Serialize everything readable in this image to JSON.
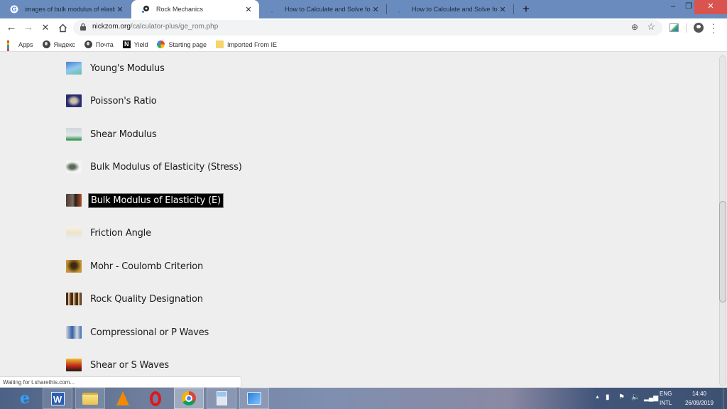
{
  "browser": {
    "tabs": [
      {
        "title": "images of bulk modulus of elastic",
        "favicon": "google-icon",
        "active": false
      },
      {
        "title": "Rock Mechanics",
        "favicon": "nickzom-icon",
        "active": true
      },
      {
        "title": "How to Calculate and Solve for S",
        "favicon": "loading-icon",
        "active": false
      },
      {
        "title": "How to Calculate and Solve for B",
        "favicon": "loading-icon",
        "active": false
      }
    ],
    "new_tab_label": "+",
    "window_controls": {
      "minimize": "–",
      "restore": "❐",
      "close": "✕"
    },
    "url": {
      "host": "nickzom.org",
      "path": "/calculator-plus/ge_rom.php"
    },
    "loading": true,
    "bookmarks": [
      {
        "label": "Apps",
        "icon": "apps-grid-icon"
      },
      {
        "label": "Яндекс",
        "icon": "globe-icon"
      },
      {
        "label": "Почта",
        "icon": "globe-icon"
      },
      {
        "label": "Yield",
        "icon": "yield-icon"
      },
      {
        "label": "Starting page",
        "icon": "starting-page-icon"
      },
      {
        "label": "Imported From IE",
        "icon": "folder-icon"
      }
    ],
    "status_text": "Waiting for t.sharethis.com...",
    "scroll_position_fraction": 0.44
  },
  "page": {
    "items": [
      {
        "label": "Young's Modulus",
        "selected": false
      },
      {
        "label": "Poisson's Ratio",
        "selected": false
      },
      {
        "label": "Shear Modulus",
        "selected": false
      },
      {
        "label": "Bulk Modulus of Elasticity (Stress)",
        "selected": false
      },
      {
        "label": "Bulk Modulus of Elasticity (E)",
        "selected": true
      },
      {
        "label": "Friction Angle",
        "selected": false
      },
      {
        "label": "Mohr - Coulomb Criterion",
        "selected": false
      },
      {
        "label": "Rock Quality Designation",
        "selected": false
      },
      {
        "label": "Compressional or P Waves",
        "selected": false
      },
      {
        "label": "Shear or S Waves",
        "selected": false
      }
    ]
  },
  "taskbar": {
    "apps": [
      "Internet Explorer",
      "Microsoft Word",
      "File Explorer",
      "VLC media player",
      "Opera",
      "Google Chrome",
      "Calculator",
      "Control Panel"
    ],
    "tray": {
      "show_hidden": "▲",
      "language_top": "ENG",
      "language_bottom": "INTL",
      "time": "14:40",
      "date": "26/09/2019"
    }
  }
}
